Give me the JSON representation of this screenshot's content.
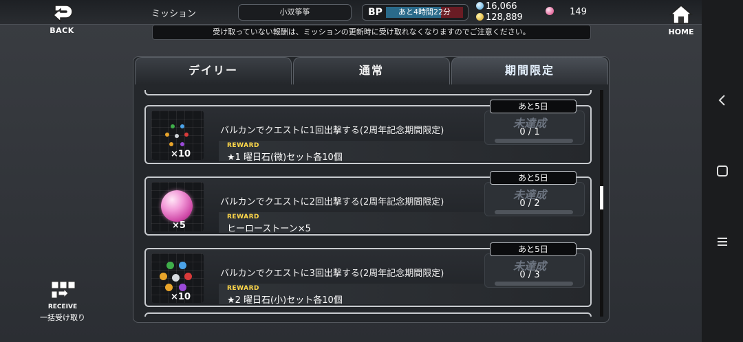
{
  "header": {
    "back_label": "BACK",
    "title": "ミッション",
    "player_name": "小双筝筝",
    "bp_label": "BP",
    "bp_timer": "あと4時間22分",
    "currency_blue": "16,066",
    "currency_gold": "128,889",
    "gem_count": "149",
    "home_label": "HOME"
  },
  "notice": "受け取っていない報酬は、ミッションの更新時に受け取れなくなりますのでご注意ください。",
  "tabs": [
    {
      "label": "デイリー",
      "active": false
    },
    {
      "label": "通常",
      "active": false
    },
    {
      "label": "期間限定",
      "active": true
    }
  ],
  "missions": [
    {
      "deadline": "あと5日",
      "title": "バルカンでクエストに1回出撃する(2周年記念期間限定)",
      "reward_label": "REWARD",
      "reward": "★1 曜日石(微)セット各10個",
      "icon": "weekday-stones-small-icon",
      "quantity": "×10",
      "status": "未達成",
      "progress_text": "0 / 1",
      "progress": 0
    },
    {
      "deadline": "あと5日",
      "title": "バルカンでクエストに2回出撃する(2周年記念期間限定)",
      "reward_label": "REWARD",
      "reward": "ヒーローストーン×5",
      "icon": "hero-stone-icon",
      "quantity": "×5",
      "status": "未達成",
      "progress_text": "0 / 2",
      "progress": 0
    },
    {
      "deadline": "あと5日",
      "title": "バルカンでクエストに3回出撃する(2周年記念期間限定)",
      "reward_label": "REWARD",
      "reward": "★2 曜日石(小)セット各10個",
      "icon": "weekday-stones-icon",
      "quantity": "×10",
      "status": "未達成",
      "progress_text": "0 / 3",
      "progress": 0
    }
  ],
  "receive_all": {
    "label": "RECEIVE",
    "sublabel": "一括受け取り"
  },
  "colors": {
    "reward_label": "#ffd84a",
    "bp_bar": "#2a6a8a",
    "bp_remaining": "#6a1c24",
    "status_text": "#6d7581"
  },
  "system_nav": {
    "icons": [
      "back-triangle-icon",
      "home-square-icon",
      "recents-menu-icon"
    ]
  }
}
